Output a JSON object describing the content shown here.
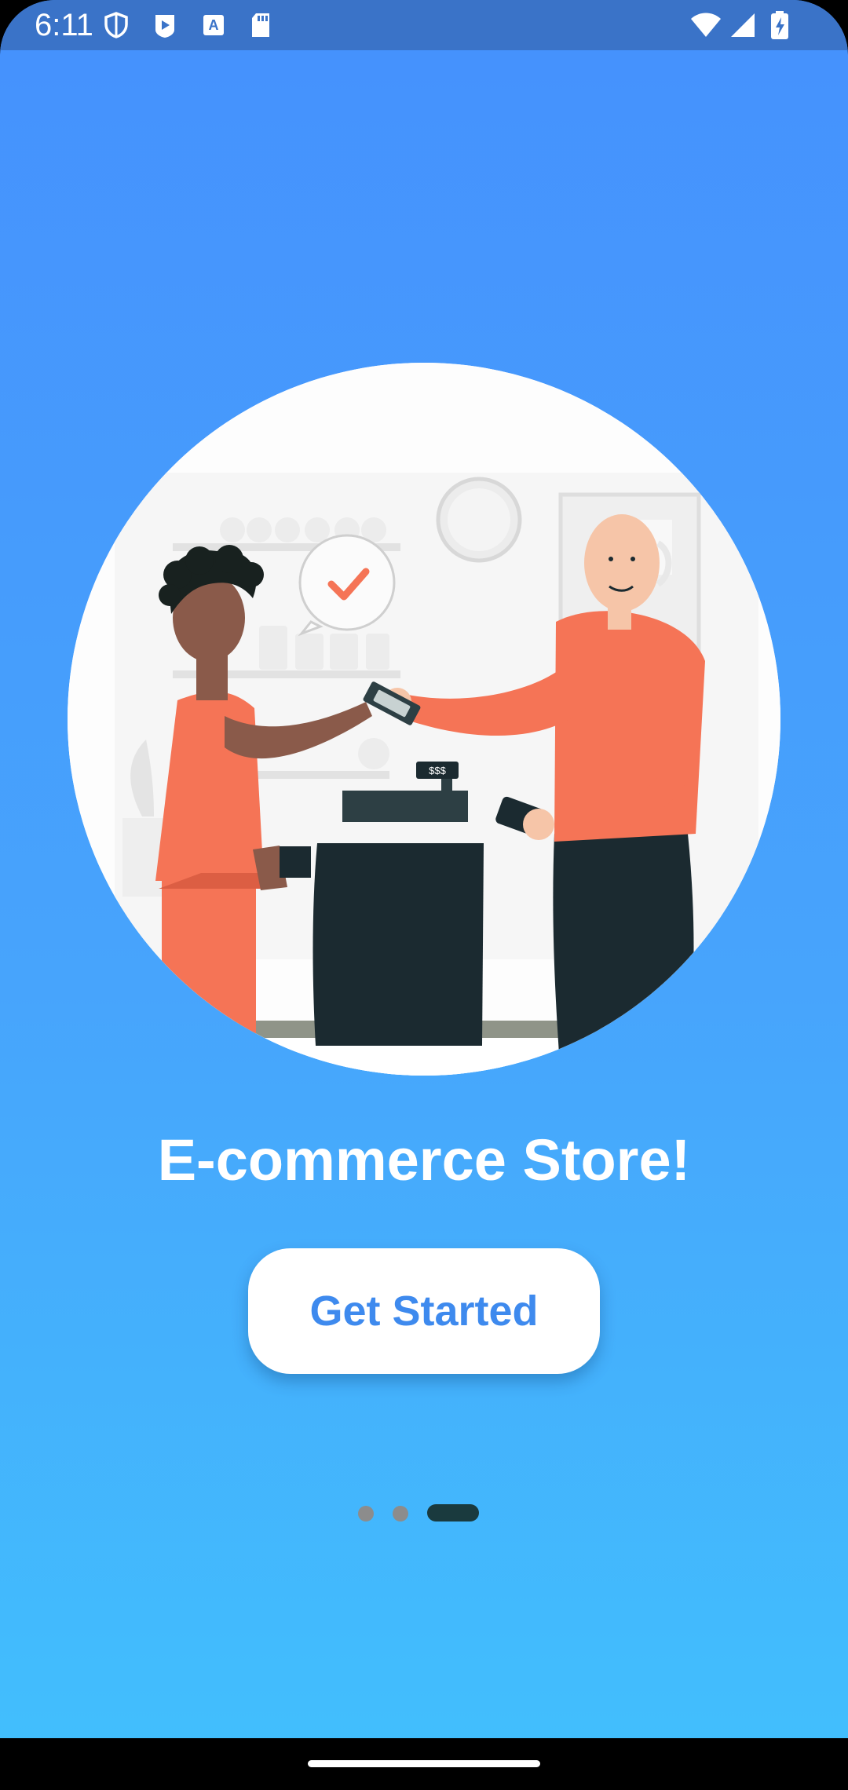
{
  "status_bar": {
    "time": "6:11",
    "left_icons": [
      "shield-icon",
      "play-store-icon",
      "keyboard-a-icon",
      "sd-card-icon"
    ],
    "right_icons": [
      "wifi-icon",
      "cellular-signal-icon",
      "battery-charging-icon"
    ]
  },
  "hero": {
    "image": "cashier-checkout-illustration",
    "register_display": "$$$"
  },
  "onboarding": {
    "title": "E-commerce Store!",
    "cta_label": "Get Started",
    "page_indicator": {
      "count": 3,
      "active_index": 2
    }
  },
  "colors": {
    "background_top": "#4591fd",
    "background_bottom": "#41c0fd",
    "status_bar": "#3a73c8",
    "accent": "#3e8aee",
    "illustration_orange": "#f57456",
    "counter_dark": "#1b2a30",
    "indicator_active": "#1a3a3e",
    "indicator_inactive": "#8c8c8c"
  }
}
